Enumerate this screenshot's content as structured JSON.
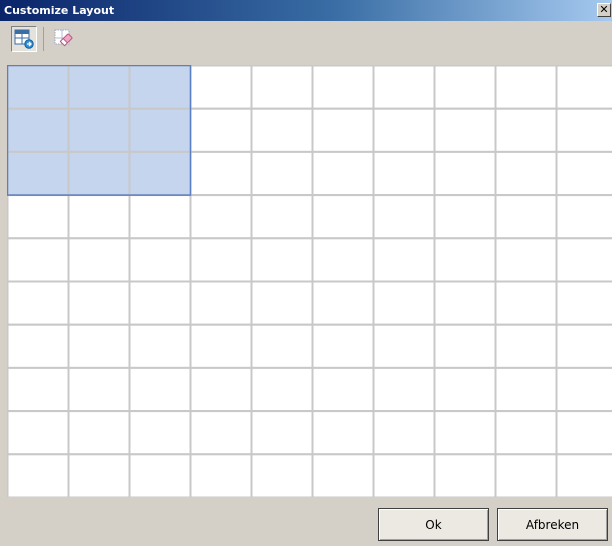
{
  "window": {
    "title": "Customize Layout",
    "close_glyph": "✕"
  },
  "toolbar": {
    "buttons": [
      {
        "icon": "table-arrow-icon",
        "pressed": true
      },
      {
        "icon": "eraser-icon",
        "pressed": false
      }
    ]
  },
  "grid": {
    "rows": 10,
    "columns": 10,
    "selection": {
      "rows": 3,
      "columns": 3
    },
    "colors": {
      "line": "#c8c8c8",
      "selection_fill": "#c5d5ee",
      "selection_border": "#5b7fc4"
    }
  },
  "footer": {
    "ok_label": "Ok",
    "cancel_label": "Afbreken"
  }
}
